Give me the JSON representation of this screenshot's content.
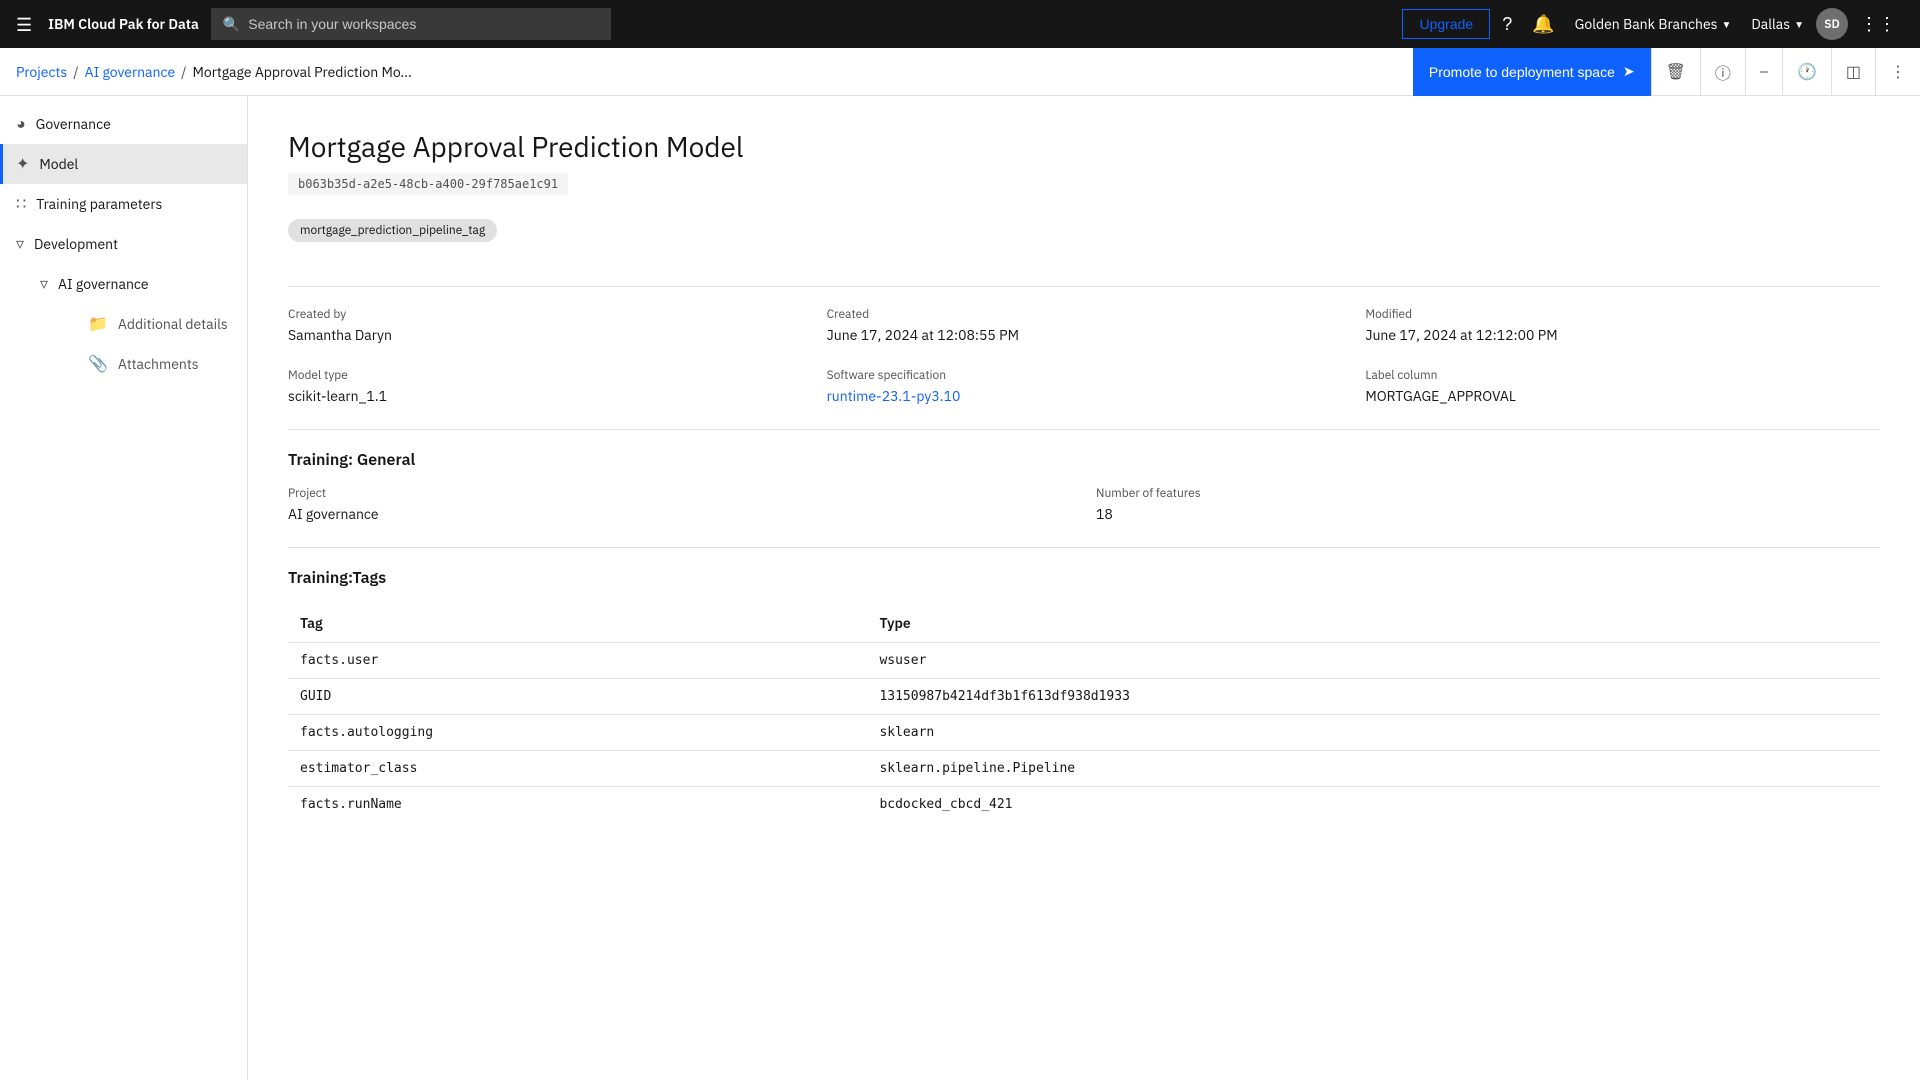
{
  "topnav": {
    "brand": "IBM Cloud Pak for Data",
    "search_placeholder": "Search in your workspaces",
    "upgrade_label": "Upgrade",
    "account": "Golden Bank Branches",
    "region": "Dallas",
    "user_initials": "SD"
  },
  "breadcrumb": {
    "projects": "Projects",
    "ai_governance": "AI governance",
    "current": "Mortgage Approval Prediction Mo...",
    "promote_label": "Promote to deployment space"
  },
  "sidebar": {
    "governance_label": "Governance",
    "model_label": "Model",
    "training_params_label": "Training parameters",
    "development_label": "Development",
    "ai_governance_label": "AI governance",
    "additional_details_label": "Additional details",
    "attachments_label": "Attachments"
  },
  "model": {
    "title": "Mortgage Approval Prediction Model",
    "id": "b063b35d-a2e5-48cb-a400-29f785ae1c91",
    "tag": "mortgage_prediction_pipeline_tag",
    "created_by_label": "Created by",
    "created_by_value": "Samantha Daryn",
    "created_label": "Created",
    "created_value": "June 17, 2024 at 12:08:55 PM",
    "modified_label": "Modified",
    "modified_value": "June 17, 2024 at 12:12:00 PM",
    "model_type_label": "Model type",
    "model_type_value": "scikit-learn_1.1",
    "software_spec_label": "Software specification",
    "software_spec_value": "runtime-23.1-py3.10",
    "label_column_label": "Label column",
    "label_column_value": "MORTGAGE_APPROVAL",
    "training_general_title": "Training: General",
    "project_label": "Project",
    "project_value": "AI governance",
    "num_features_label": "Number of features",
    "num_features_value": "18",
    "training_tags_title": "Training:Tags",
    "tag_col": "Tag",
    "type_col": "Type",
    "tags": [
      {
        "tag": "facts.user",
        "type": "wsuser"
      },
      {
        "tag": "GUID",
        "type": "13150987b4214df3b1f613df938d1933"
      },
      {
        "tag": "facts.autologging",
        "type": "sklearn"
      },
      {
        "tag": "estimator_class",
        "type": "sklearn.pipeline.Pipeline"
      },
      {
        "tag": "facts.runName",
        "type": "bcdocked_cbcd_421"
      }
    ]
  }
}
